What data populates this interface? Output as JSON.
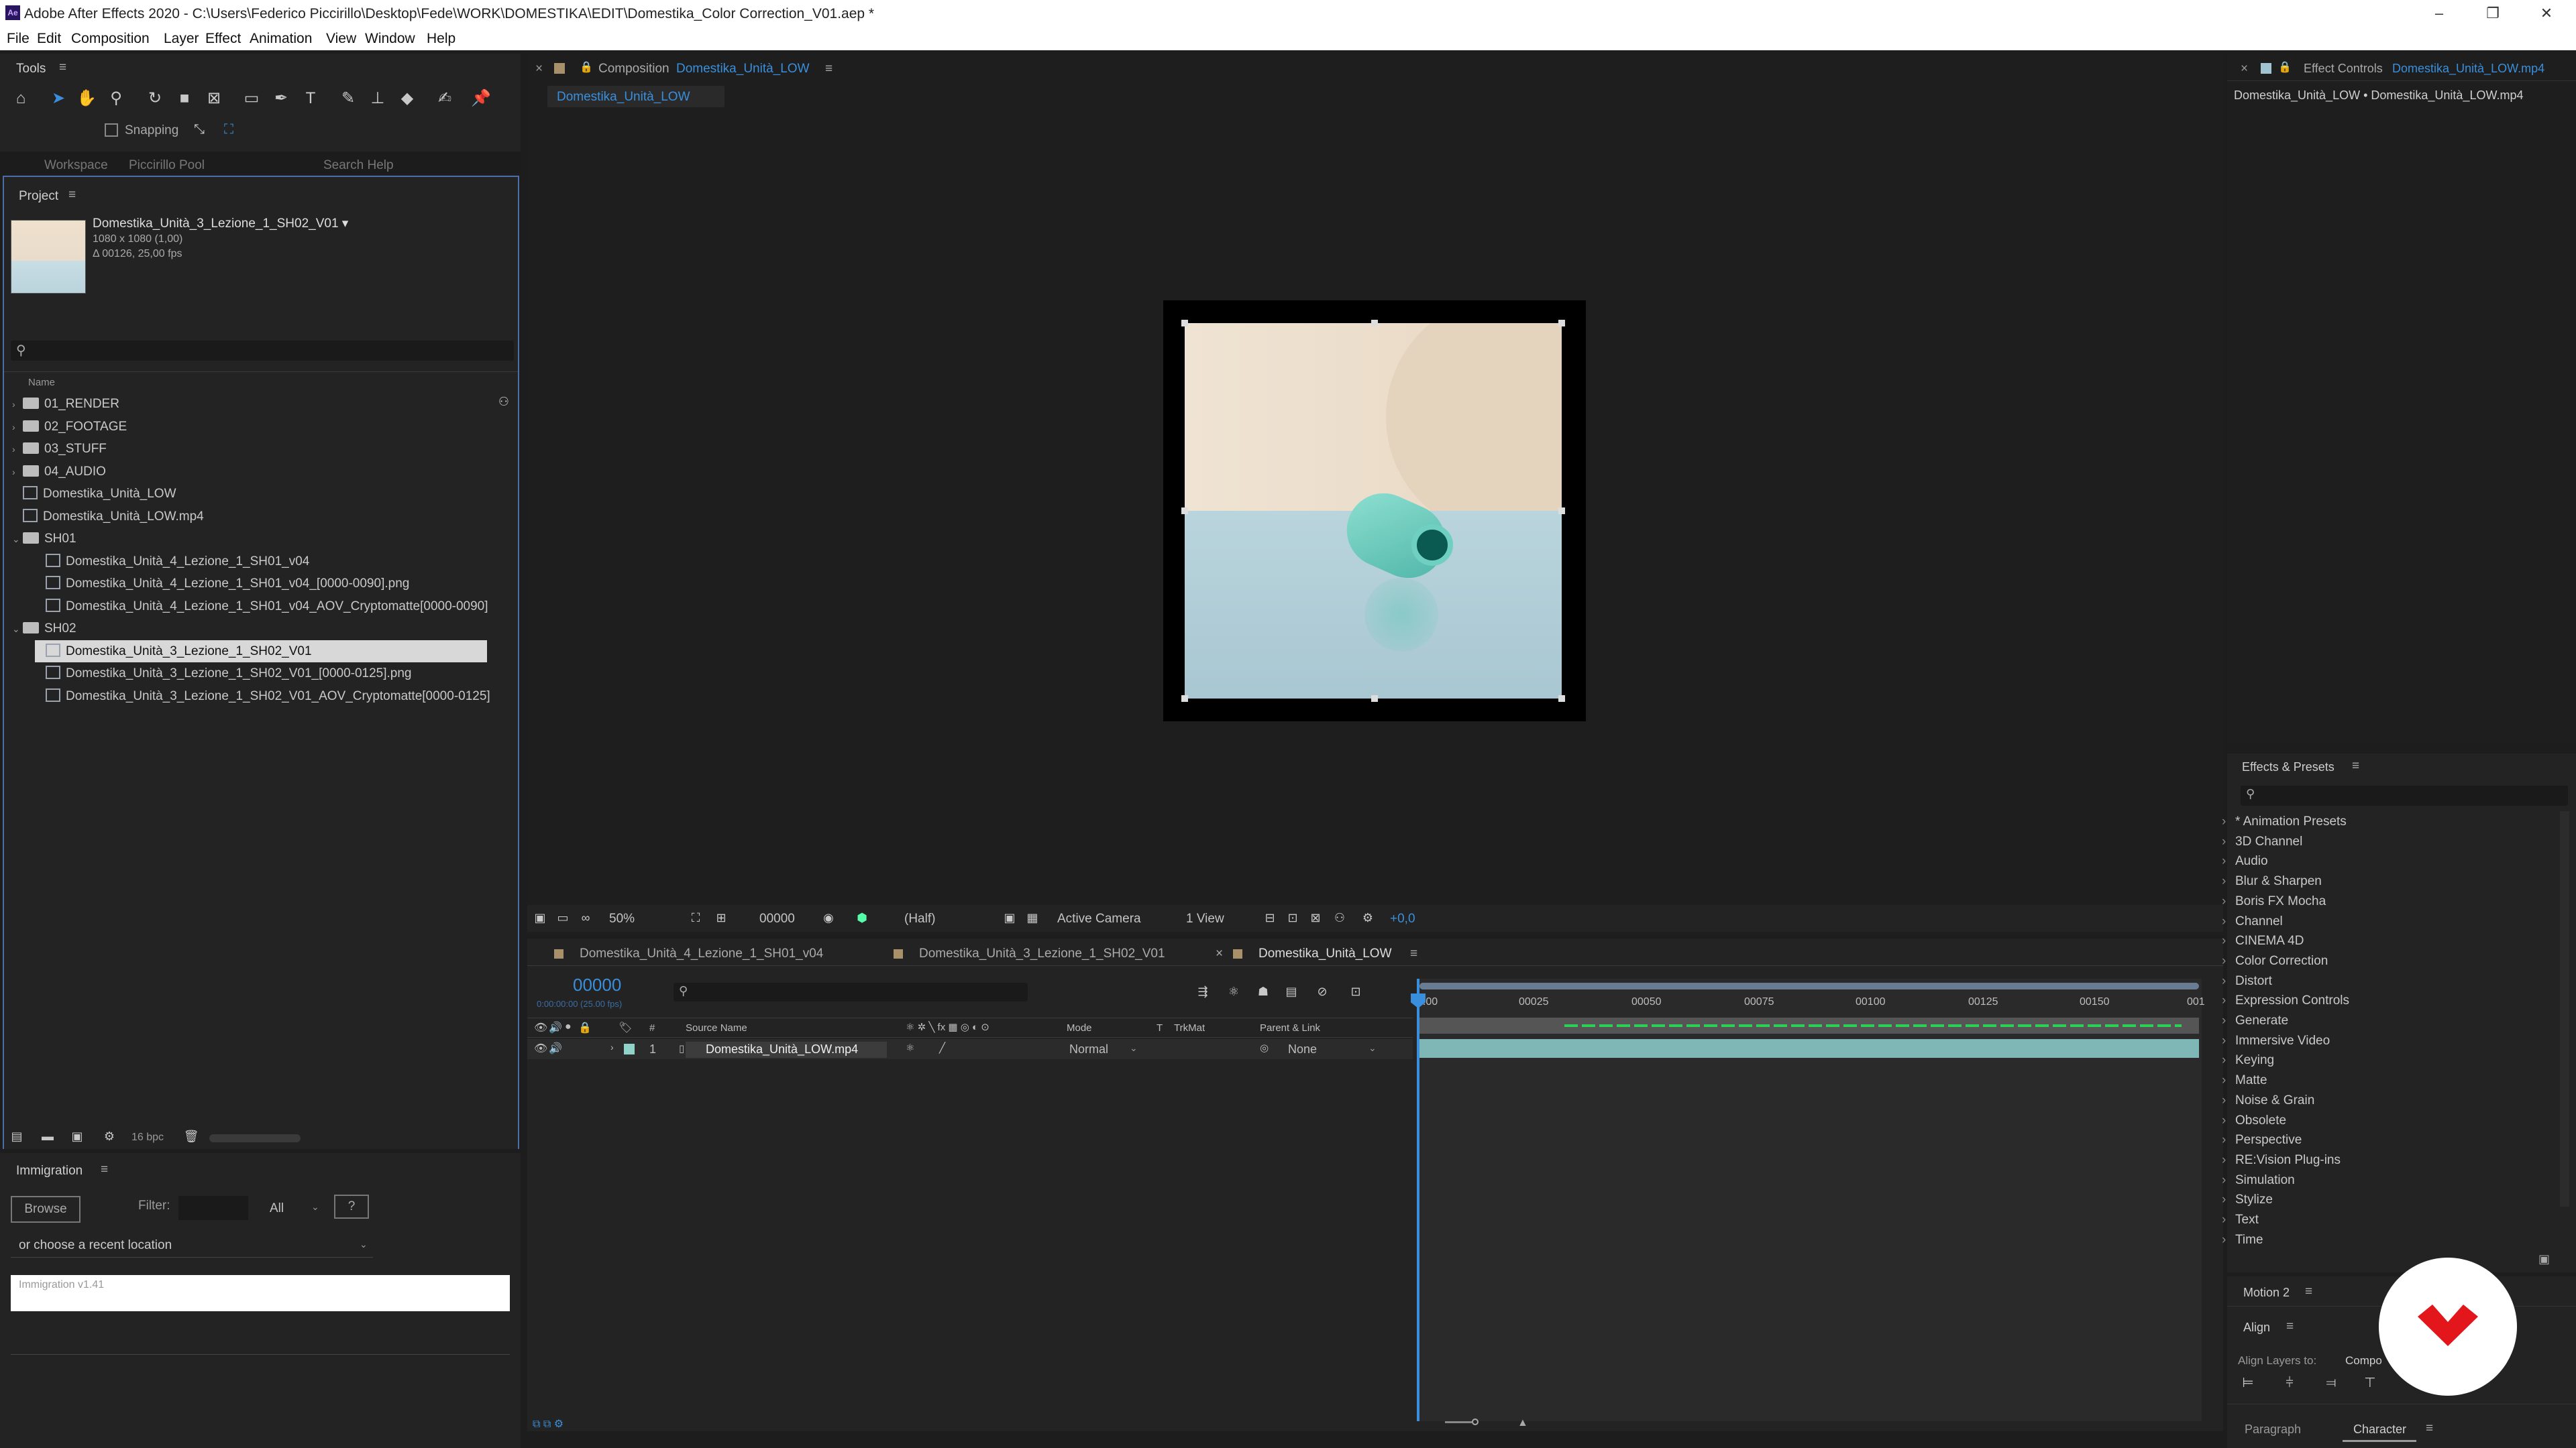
{
  "titlebar": {
    "title": "Adobe After Effects 2020 - C:\\Users\\Federico Piccirillo\\Desktop\\Fede\\WORK\\DOMESTIKA\\EDIT\\Domestika_Color Correction_V01.aep *"
  },
  "menu": [
    "File",
    "Edit",
    "Composition",
    "Layer",
    "Effect",
    "Animation",
    "View",
    "Window",
    "Help"
  ],
  "tools": {
    "title": "Tools",
    "snapping": "Snapping",
    "workspace": "Workspace",
    "workspace_value": "Piccirillo Pool",
    "search": "Search Help"
  },
  "project": {
    "title": "Project",
    "selected_name": "Domestika_Unità_3_Lezione_1_SH02_V01 ▾",
    "selected_size": "1080 x 1080 (1,00)",
    "selected_duration": "Δ 00126, 25,00 fps",
    "col_name": "Name",
    "bpc": "16 bpc",
    "items": [
      {
        "label": "01_RENDER",
        "type": "folder",
        "indent": 0,
        "arrow": "›"
      },
      {
        "label": "02_FOOTAGE",
        "type": "folder",
        "indent": 0,
        "arrow": "›"
      },
      {
        "label": "03_STUFF",
        "type": "folder",
        "indent": 0,
        "arrow": "›"
      },
      {
        "label": "04_AUDIO",
        "type": "folder",
        "indent": 0,
        "arrow": "›"
      },
      {
        "label": "Domestika_Unità_LOW",
        "type": "comp",
        "indent": 0,
        "arrow": ""
      },
      {
        "label": "Domestika_Unità_LOW.mp4",
        "type": "file",
        "indent": 0,
        "arrow": ""
      },
      {
        "label": "SH01",
        "type": "folder",
        "indent": 0,
        "arrow": "⌄"
      },
      {
        "label": "Domestika_Unità_4_Lezione_1_SH01_v04",
        "type": "comp",
        "indent": 1,
        "arrow": ""
      },
      {
        "label": "Domestika_Unità_4_Lezione_1_SH01_v04_[0000-0090].png",
        "type": "file",
        "indent": 1,
        "arrow": ""
      },
      {
        "label": "Domestika_Unità_4_Lezione_1_SH01_v04_AOV_Cryptomatte[0000-0090]",
        "type": "file",
        "indent": 1,
        "arrow": ""
      },
      {
        "label": "SH02",
        "type": "folder",
        "indent": 0,
        "arrow": "⌄"
      },
      {
        "label": "Domestika_Unità_3_Lezione_1_SH02_V01",
        "type": "comp",
        "indent": 1,
        "arrow": "",
        "selected": true
      },
      {
        "label": "Domestika_Unità_3_Lezione_1_SH02_V01_[0000-0125].png",
        "type": "file",
        "indent": 1,
        "arrow": ""
      },
      {
        "label": "Domestika_Unità_3_Lezione_1_SH02_V01_AOV_Cryptomatte[0000-0125]",
        "type": "file",
        "indent": 1,
        "arrow": ""
      }
    ]
  },
  "immigration": {
    "title": "Immigration",
    "browse": "Browse",
    "filter_label": "Filter:",
    "filter_value": "All",
    "help": "?",
    "recent": "or choose a recent location",
    "version": "Immigration  v1.41"
  },
  "composition": {
    "panel_label": "Composition",
    "comp_name": "Domestika_Unità_LOW",
    "tab": "Domestika_Unità_LOW"
  },
  "viewer_bar": {
    "zoom": "50%",
    "timecode": "00000",
    "resolution": "(Half)",
    "camera": "Active Camera",
    "views": "1 View",
    "exposure": "+0,0"
  },
  "effect_controls": {
    "label": "Effect Controls",
    "layer": "Domestika_Unità_LOW.mp4",
    "path": "Domestika_Unità_LOW • Domestika_Unità_LOW.mp4"
  },
  "effects": {
    "title": "Effects & Presets",
    "items": [
      "* Animation Presets",
      "3D Channel",
      "Audio",
      "Blur & Sharpen",
      "Boris FX Mocha",
      "Channel",
      "CINEMA 4D",
      "Color Correction",
      "Distort",
      "Expression Controls",
      "Generate",
      "Immersive Video",
      "Keying",
      "Matte",
      "Noise & Grain",
      "Obsolete",
      "Perspective",
      "RE:Vision Plug-ins",
      "Simulation",
      "Stylize",
      "Text",
      "Time"
    ]
  },
  "motion": {
    "title": "Motion 2"
  },
  "align": {
    "title": "Align",
    "layers_to": "Align Layers to:",
    "target": "Compo"
  },
  "character": {
    "paragraph": "Paragraph",
    "character": "Character"
  },
  "timeline": {
    "tabs": [
      "Domestika_Unità_4_Lezione_1_SH01_v04",
      "Domestika_Unità_3_Lezione_1_SH02_V01",
      "Domestika_Unità_LOW"
    ],
    "timecode": "00000",
    "timecode_sub": "0:00:00:00 (25.00 fps)",
    "cols": {
      "num": "#",
      "source": "Source Name",
      "mode": "Mode",
      "t": "T",
      "trkmat": "TrkMat",
      "parent": "Parent & Link"
    },
    "layer": {
      "num": "1",
      "name": "Domestika_Unità_LOW.mp4",
      "mode": "Normal",
      "parent": "None"
    },
    "ruler": [
      "0:00",
      "00025",
      "00050",
      "00075",
      "00100",
      "00125",
      "00150",
      "001"
    ]
  }
}
